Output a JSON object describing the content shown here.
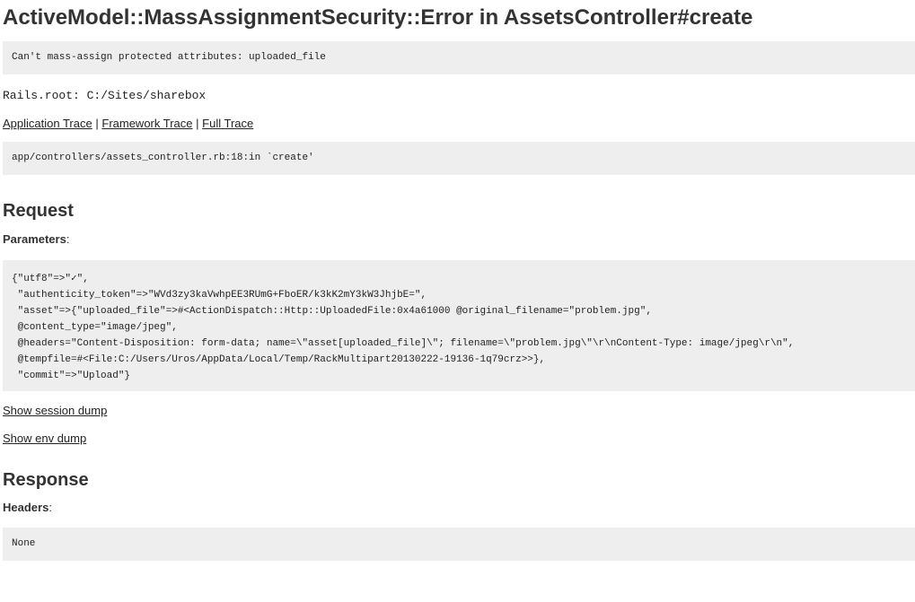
{
  "title": "ActiveModel::MassAssignmentSecurity::Error in AssetsController#create",
  "error_message": "Can't mass-assign protected attributes: uploaded_file",
  "rails_root": "Rails.root: C:/Sites/sharebox",
  "trace_links": {
    "application": "Application Trace",
    "separator": "|",
    "framework": "Framework Trace",
    "full": "Full Trace"
  },
  "trace_line": "app/controllers/assets_controller.rb:18:in `create'",
  "request": {
    "heading": "Request",
    "parameters_label": "Parameters",
    "colon": ":",
    "parameters_dump": "{\"utf8\"=>\"✓\",\n \"authenticity_token\"=>\"WVd3zy3kaVwhpEE3RUmG+FboER/k3kK2mY3kW3JhjbE=\",\n \"asset\"=>{\"uploaded_file\"=>#<ActionDispatch::Http::UploadedFile:0x4a61000 @original_filename=\"problem.jpg\",\n @content_type=\"image/jpeg\",\n @headers=\"Content-Disposition: form-data; name=\\\"asset[uploaded_file]\\\"; filename=\\\"problem.jpg\\\"\\r\\nContent-Type: image/jpeg\\r\\n\",\n @tempfile=#<File:C:/Users/Uros/AppData/Local/Temp/RackMultipart20130222-19136-1q79crz>>},\n \"commit\"=>\"Upload\"}",
    "show_session_dump": "Show session dump",
    "show_env_dump": "Show env dump"
  },
  "response": {
    "heading": "Response",
    "headers_label": "Headers",
    "colon": ":",
    "headers_value": "None"
  }
}
